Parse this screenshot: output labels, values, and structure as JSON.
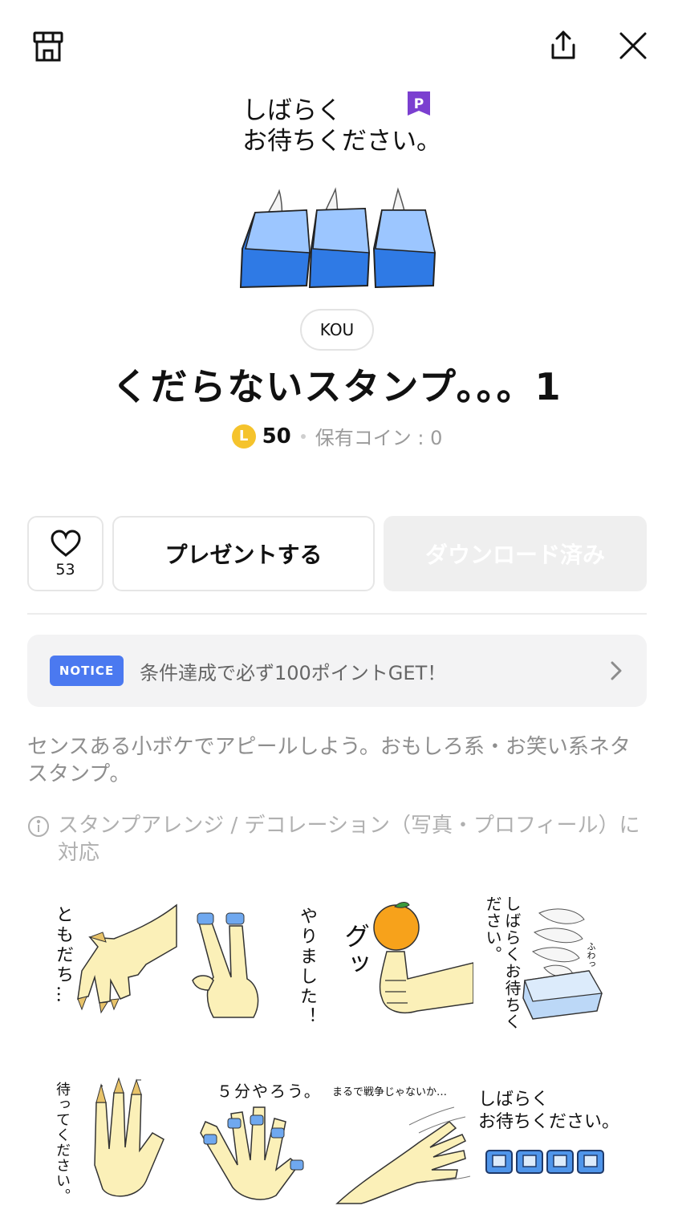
{
  "header": {
    "shop_icon": "shop-icon",
    "share_icon": "share-icon",
    "close_icon": "close-icon"
  },
  "hero": {
    "text_line1": "しばらく",
    "text_line2": "お待ちください。",
    "premium_badge": "P"
  },
  "creator": "KOU",
  "title": "くだらないスタンプ。。。1",
  "price": {
    "coin_letter": "L",
    "value": "50",
    "owned": "保有コイン : 0"
  },
  "actions": {
    "like_count": "53",
    "present_label": "プレゼントする",
    "download_label": "ダウンロード済み"
  },
  "notice": {
    "badge": "NOTICE",
    "text": "条件達成で必ず100ポイントGET！"
  },
  "description": "センスある小ボケでアピールしよう。おもしろ系・お笑い系ネタスタンプ。",
  "arrange_note": "スタンプアレンジ / デコレーション（写真・プロフィール）に対応",
  "stickers": [
    {
      "text": "ともだち…"
    },
    {
      "text": "やりました！"
    },
    {
      "text": "グッ"
    },
    {
      "text": "しばらくお待ちください。",
      "sfx": "ふわっ"
    },
    {
      "text": "待ってください。"
    },
    {
      "text": "５分やろう。"
    },
    {
      "text": "まるで戦争じゃないか…"
    },
    {
      "text_line1": "しばらく",
      "text_line2": "お待ちください。"
    }
  ],
  "colors": {
    "notice_badge": "#4b79f0",
    "coin": "#f5c32c",
    "premium": "#7b3fd0",
    "tissue_blue": "#2f7ae5"
  }
}
